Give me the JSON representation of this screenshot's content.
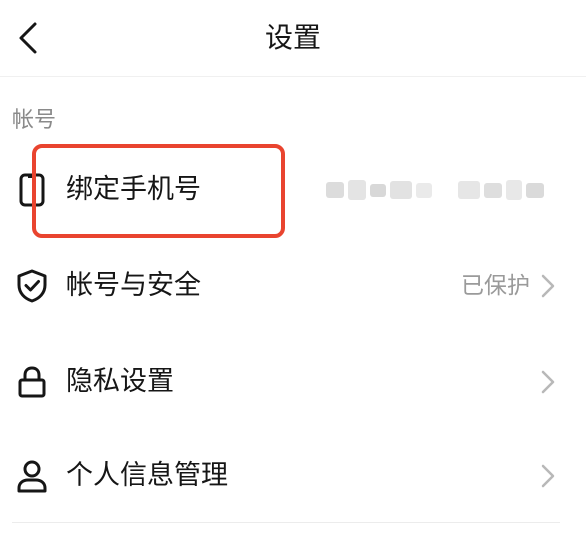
{
  "header": {
    "title": "设置",
    "back_icon": "chevron-left-icon"
  },
  "account_section": {
    "title": "帐号",
    "items": [
      {
        "label": "绑定手机号",
        "icon": "phone-icon",
        "value": "",
        "value_masked": true,
        "highlighted": true
      },
      {
        "label": "帐号与安全",
        "icon": "shield-check-icon",
        "value": "已保护"
      },
      {
        "label": "隐私设置",
        "icon": "lock-icon",
        "value": ""
      },
      {
        "label": "个人信息管理",
        "icon": "user-icon",
        "value": ""
      }
    ]
  },
  "colors": {
    "text_primary": "#161616",
    "text_secondary": "#9a9a9a",
    "section_title": "#8a8a8a",
    "highlight": "#e9442f",
    "divider": "#ececec"
  }
}
